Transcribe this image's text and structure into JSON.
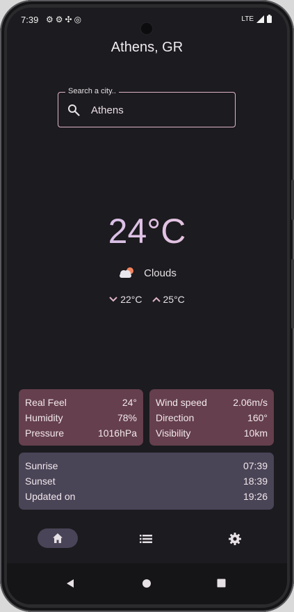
{
  "status_bar": {
    "time": "7:39",
    "network": "LTE",
    "icons": [
      "settings-icon",
      "settings-icon",
      "location-icon",
      "sync-icon",
      "signal-icon",
      "battery-icon"
    ]
  },
  "header": {
    "city": "Athens, GR"
  },
  "search": {
    "label": "Search a city..",
    "value": "Athens"
  },
  "current": {
    "temperature": "24°C",
    "condition": "Clouds",
    "condition_icon": "cloud-sun-icon",
    "min_temp": "22°C",
    "max_temp": "25°C"
  },
  "details_left": [
    {
      "label": "Real Feel",
      "value": "24°"
    },
    {
      "label": "Humidity",
      "value": "78%"
    },
    {
      "label": "Pressure",
      "value": "1016hPa"
    }
  ],
  "details_right": [
    {
      "label": "Wind speed",
      "value": "2.06m/s"
    },
    {
      "label": "Direction",
      "value": "160°"
    },
    {
      "label": "Visibility",
      "value": "10km"
    }
  ],
  "sun": [
    {
      "label": "Sunrise",
      "value": "07:39"
    },
    {
      "label": "Sunset",
      "value": "18:39"
    },
    {
      "label": "Updated on",
      "value": "19:26"
    }
  ],
  "bottom_nav": {
    "items": [
      "home-icon",
      "list-icon",
      "settings-icon"
    ],
    "active": "home-icon"
  },
  "colors": {
    "background": "#1c1b1f",
    "card_primary": "#653f4d",
    "card_secondary": "#4a4457",
    "search_outline": "#e0b6c8",
    "nav_active_pill": "#4a4458"
  }
}
